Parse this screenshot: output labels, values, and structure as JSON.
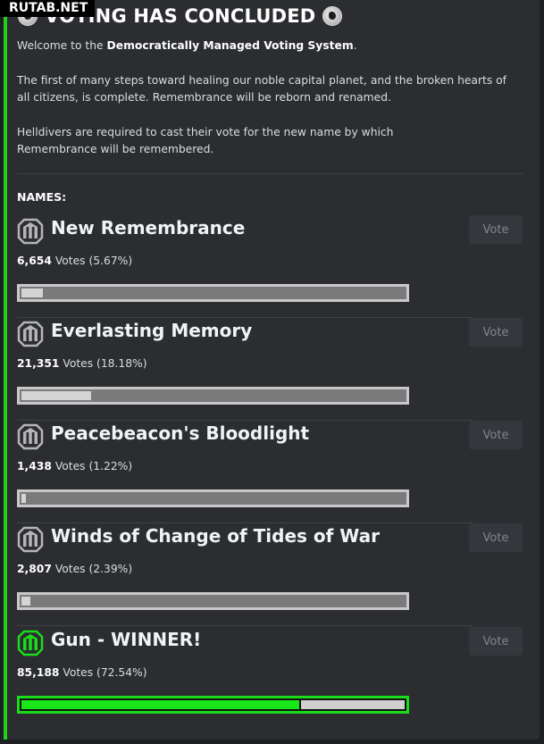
{
  "watermark": "RUTAB.NET",
  "header": {
    "title": "VOTING HAS CONCLUDED"
  },
  "intro": {
    "welcome_prefix": "Welcome to the ",
    "welcome_system": "Democratically Managed Voting System",
    "welcome_suffix": ".",
    "paragraph2": "The first of many steps toward healing our noble capital planet, and the broken hearts of all citizens, is complete. Remembrance will be reborn and renamed.",
    "paragraph3": "Helldivers are required to cast their vote for the new name by which Remembrance will be remembered."
  },
  "names_label": "NAMES:",
  "vote_label": "Vote",
  "options": [
    {
      "name": "New Remembrance",
      "votes": "6,654",
      "pct_text": " Votes (5.67%)",
      "share": 0.0567,
      "winner": false
    },
    {
      "name": "Everlasting Memory",
      "votes": "21,351",
      "pct_text": " Votes (18.18%)",
      "share": 0.1818,
      "winner": false
    },
    {
      "name": "Peacebeacon's Bloodlight",
      "votes": "1,438",
      "pct_text": " Votes (1.22%)",
      "share": 0.0122,
      "winner": false
    },
    {
      "name": "Winds of Change of Tides of War",
      "votes": "2,807",
      "pct_text": " Votes (2.39%)",
      "share": 0.0239,
      "winner": false
    },
    {
      "name": "Gun - WINNER!",
      "votes": "85,188",
      "pct_text": " Votes (72.54%)",
      "share": 0.7254,
      "winner": true
    }
  ],
  "colors": {
    "accent": "#23d11b",
    "winner_fill": "#19e619",
    "bar_fill": "#d4d4d4",
    "bar_empty": "#7a7a7a"
  }
}
